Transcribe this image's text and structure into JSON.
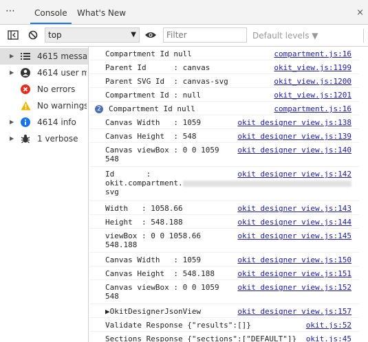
{
  "tabs": {
    "more": "⋯",
    "items": [
      {
        "label": "Console",
        "active": true
      },
      {
        "label": "What's New",
        "active": false
      }
    ],
    "close": "×"
  },
  "toolbar": {
    "context": "top",
    "filter_placeholder": "Filter",
    "levels": "Default levels ▼"
  },
  "sidebar": {
    "items": [
      {
        "label": "4615 messa...",
        "icon": "list-icon",
        "selected": true
      },
      {
        "label": "4614 user m...",
        "icon": "user-icon",
        "selected": false
      },
      {
        "label": "No errors",
        "icon": "error-icon",
        "selected": false
      },
      {
        "label": "No warnings",
        "icon": "warning-icon",
        "selected": false
      },
      {
        "label": "4614 info",
        "icon": "info-icon",
        "selected": false
      },
      {
        "label": "1 verbose",
        "icon": "bug-icon",
        "selected": false
      }
    ]
  },
  "console": {
    "rows": [
      {
        "msg": "Compartment Id null",
        "src": "compartment.js:16"
      },
      {
        "msg": "Parent Id      : canvas",
        "src": "okit_view.js:1199"
      },
      {
        "msg": "Parent SVG Id  : canvas-svg",
        "src": "okit_view.js:1200"
      },
      {
        "msg": "Compartment Id : null",
        "src": "okit_view.js:1201"
      },
      {
        "msg": "Compartment Id null",
        "src": "compartment.js:16",
        "badge": "2"
      },
      {
        "msg": "Canvas Width   : 1059",
        "src": "okit designer view.js:138"
      },
      {
        "msg": "Canvas Height  : 548",
        "src": "okit designer view.js:139"
      },
      {
        "msg": "Canvas viewBox : 0 0 1059\n548",
        "src": "okit designer view.js:140"
      },
      {
        "msg": "Id       :\nokit.compartment.",
        "msg_tail": "svg",
        "src": "okit designer view.js:142"
      },
      {
        "msg": "Width   : 1058.66",
        "src": "okit designer view.js:143"
      },
      {
        "msg": "Height  : 548.188",
        "src": "okit designer view.js:144"
      },
      {
        "msg": "viewBox : 0 0 1058.66\n548.188",
        "src": "okit designer view.js:145"
      },
      {
        "msg": "Canvas Width   : 1059",
        "src": "okit designer view.js:150"
      },
      {
        "msg": "Canvas Height  : 548.188",
        "src": "okit designer view.js:151"
      },
      {
        "msg": "Canvas viewBox : 0 0 1059\n548",
        "src": "okit designer view.js:152"
      },
      {
        "msg": "▶OkitDesignerJsonView",
        "src": "okit designer view.js:157"
      },
      {
        "msg": "Validate Response {\"results\":[]}",
        "src": "okit.js:52"
      },
      {
        "msg": "Sections Response {\"sections\":[\"DEFAULT\"]}",
        "src": "okit.js:45"
      }
    ]
  }
}
